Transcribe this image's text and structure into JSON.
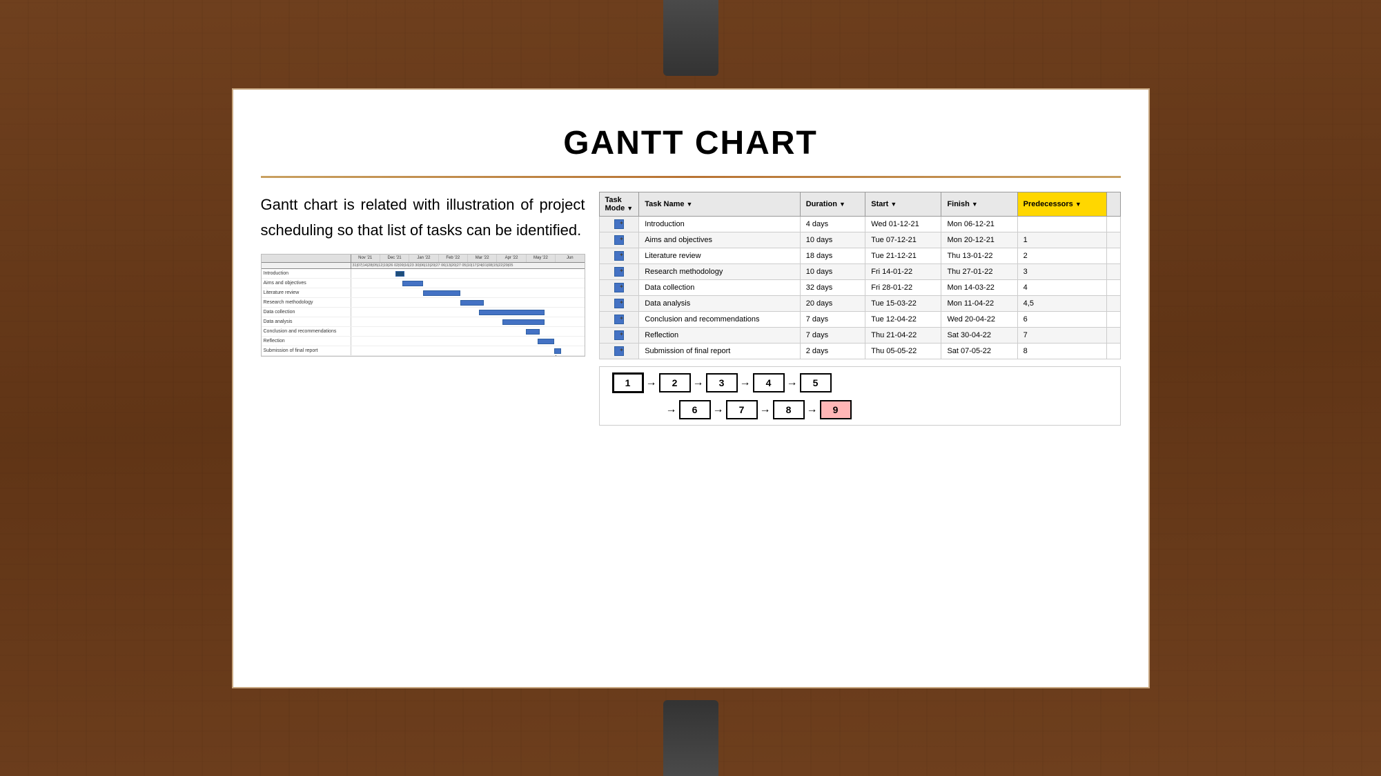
{
  "slide": {
    "title": "GANTT CHART",
    "divider_color": "#b87333",
    "description": "Gantt chart is related with illustration of project scheduling so that list of tasks can be identified."
  },
  "table": {
    "headers": [
      "Task Mode",
      "Task Name",
      "Duration",
      "Start",
      "Finish",
      "Predecessors"
    ],
    "rows": [
      {
        "mode": "⬡",
        "name": "Introduction",
        "duration": "4 days",
        "start": "Wed 01-12-21",
        "finish": "Mon 06-12-21",
        "predecessors": ""
      },
      {
        "mode": "⬡",
        "name": "Aims and objectives",
        "duration": "10 days",
        "start": "Tue 07-12-21",
        "finish": "Mon 20-12-21",
        "predecessors": "1"
      },
      {
        "mode": "⬡",
        "name": "Literature review",
        "duration": "18 days",
        "start": "Tue 21-12-21",
        "finish": "Thu 13-01-22",
        "predecessors": "2"
      },
      {
        "mode": "⬡",
        "name": "Research methodology",
        "duration": "10 days",
        "start": "Fri 14-01-22",
        "finish": "Thu 27-01-22",
        "predecessors": "3"
      },
      {
        "mode": "⬡",
        "name": "Data collection",
        "duration": "32 days",
        "start": "Fri 28-01-22",
        "finish": "Mon 14-03-22",
        "predecessors": "4"
      },
      {
        "mode": "⬡",
        "name": "Data analysis",
        "duration": "20 days",
        "start": "Tue 15-03-22",
        "finish": "Mon 11-04-22",
        "predecessors": "4,5"
      },
      {
        "mode": "⬡",
        "name": "Conclusion and recommendations",
        "duration": "7 days",
        "start": "Tue 12-04-22",
        "finish": "Wed 20-04-22",
        "predecessors": "6"
      },
      {
        "mode": "⬡",
        "name": "Reflection",
        "duration": "7 days",
        "start": "Thu 21-04-22",
        "finish": "Sat 30-04-22",
        "predecessors": "7"
      },
      {
        "mode": "⬡",
        "name": "Submission of final report",
        "duration": "2 days",
        "start": "Thu 05-05-22",
        "finish": "Sat 07-05-22",
        "predecessors": "8"
      }
    ]
  },
  "flow": {
    "top_row": [
      "1",
      "2",
      "3",
      "4",
      "5"
    ],
    "bottom_row": [
      "6",
      "7",
      "8",
      "9"
    ],
    "highlighted": "1",
    "pink": "9"
  },
  "gantt_mini": {
    "months": [
      "Nov '21",
      "Dec '21",
      "Jan '22",
      "Feb '22",
      "Mar '22",
      "Apr '22",
      "May '22",
      "Jun"
    ],
    "tasks": [
      {
        "label": "Introduction",
        "offset": 0,
        "width": 5
      },
      {
        "label": "Aims and objectives",
        "offset": 5,
        "width": 9
      },
      {
        "label": "Literature review",
        "offset": 14,
        "width": 16
      },
      {
        "label": "Research methodology",
        "offset": 28,
        "width": 9
      },
      {
        "label": "Data collection",
        "offset": 36,
        "width": 28
      },
      {
        "label": "Data analysis",
        "offset": 52,
        "width": 18
      },
      {
        "label": "Conclusion and recommendations",
        "offset": 65,
        "width": 6
      },
      {
        "label": "Reflection",
        "offset": 71,
        "width": 7
      },
      {
        "label": "Submission of final report",
        "offset": 80,
        "width": 3
      }
    ]
  },
  "clips": {
    "top_label": "clip-top",
    "bottom_label": "clip-bottom"
  }
}
